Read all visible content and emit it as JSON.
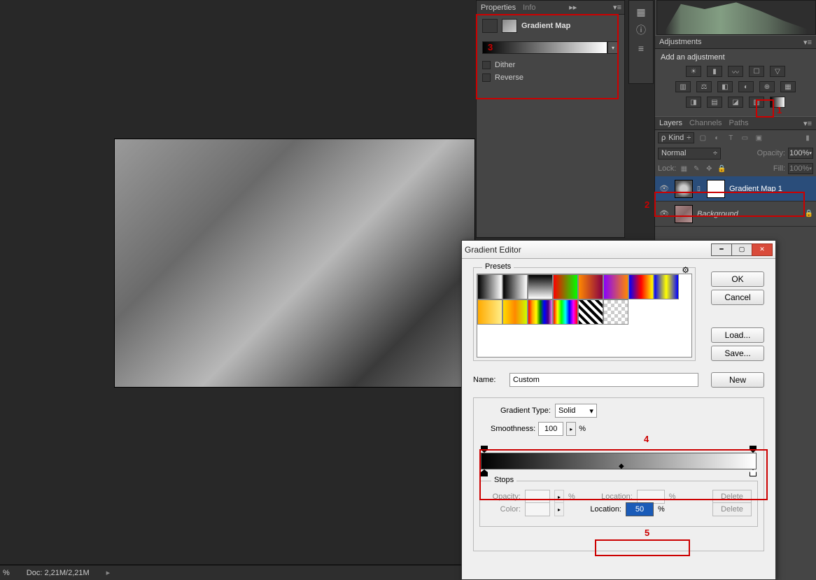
{
  "status_bar": {
    "percent": "%",
    "doc": "Doc: 2,21M/2,21M"
  },
  "properties": {
    "tabs": {
      "properties": "Properties",
      "info": "Info"
    },
    "title": "Gradient Map",
    "dither": "Dither",
    "reverse": "Reverse"
  },
  "adjustments": {
    "header": "Adjustments",
    "label": "Add an adjustment"
  },
  "layers": {
    "tabs": {
      "layers": "Layers",
      "channels": "Channels",
      "paths": "Paths"
    },
    "kind": "Kind",
    "blend": "Normal",
    "opacity_lbl": "Opacity:",
    "opacity_val": "100%",
    "lock_lbl": "Lock:",
    "fill_lbl": "Fill:",
    "fill_val": "100%",
    "items": [
      {
        "name": "Gradient Map 1"
      },
      {
        "name": "Background"
      }
    ]
  },
  "gradient_editor": {
    "title": "Gradient Editor",
    "ok": "OK",
    "cancel": "Cancel",
    "load": "Load...",
    "save": "Save...",
    "presets_lbl": "Presets",
    "name_lbl": "Name:",
    "name_val": "Custom",
    "new_btn": "New",
    "type_lbl": "Gradient Type:",
    "type_val": "Solid",
    "smooth_lbl": "Smoothness:",
    "smooth_val": "100",
    "pct": "%",
    "stops_lbl": "Stops",
    "opacity_lbl": "Opacity:",
    "color_lbl": "Color:",
    "location_lbl": "Location:",
    "location_val": "50",
    "delete": "Delete"
  },
  "annotations": {
    "1": "1",
    "2": "2",
    "3": "3",
    "4": "4",
    "5": "5"
  }
}
